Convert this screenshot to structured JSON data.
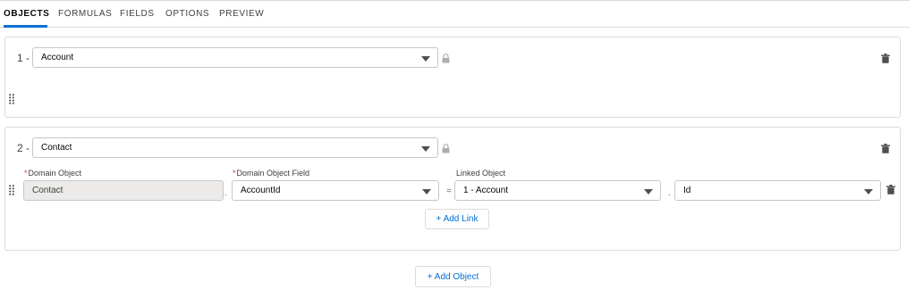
{
  "tabs": [
    "OBJECTS",
    "FORMULAS",
    "FIELDS",
    "OPTIONS",
    "PREVIEW"
  ],
  "objects": [
    {
      "number": "1 -",
      "selected": "Account"
    },
    {
      "number": "2 -",
      "selected": "Contact",
      "link": {
        "domain_object_label": "Domain Object",
        "domain_object_value": "Contact",
        "domain_field_label": "Domain Object Field",
        "domain_field_value": "AccountId",
        "linked_object_label": "Linked Object",
        "linked_object_value": "1 - Account",
        "linked_field_value": "Id",
        "required_marker": "*",
        "separator": "."
      },
      "add_link_label": "+ Add Link"
    }
  ],
  "add_object_label": "+ Add Object",
  "colors": {
    "accent": "#0070d2",
    "border": "#dddbda",
    "required": "#c23934"
  },
  "icons": [
    "lock-icon",
    "trash-icon",
    "drag-handle-icon",
    "chevron-down-icon"
  ]
}
